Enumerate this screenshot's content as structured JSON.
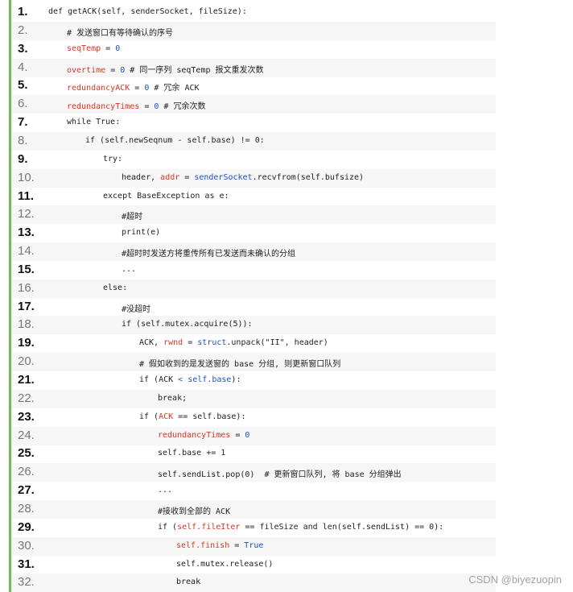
{
  "lines": [
    {
      "no": "1.",
      "tokens": [
        {
          "t": "def getACK(self, senderSocket, fileSize):"
        }
      ]
    },
    {
      "no": "2.",
      "tokens": [
        {
          "t": "# 发送窗口有等待确认的序号"
        }
      ]
    },
    {
      "no": "3.",
      "tokens": [
        {
          "t": "seqTemp",
          "c": "red"
        },
        {
          "t": " = "
        },
        {
          "t": "0",
          "c": "blue"
        }
      ]
    },
    {
      "no": "4.",
      "tokens": [
        {
          "t": "overtime",
          "c": "red"
        },
        {
          "t": " = "
        },
        {
          "t": "0",
          "c": "blue"
        },
        {
          "t": " # 同一序列 seqTemp 报文重发次数"
        }
      ]
    },
    {
      "no": "5.",
      "tokens": [
        {
          "t": "redundancyACK",
          "c": "red"
        },
        {
          "t": " = "
        },
        {
          "t": "0",
          "c": "blue"
        },
        {
          "t": " # 冗余 ACK"
        }
      ]
    },
    {
      "no": "6.",
      "tokens": [
        {
          "t": "redundancyTimes",
          "c": "red"
        },
        {
          "t": " = "
        },
        {
          "t": "0",
          "c": "blue"
        },
        {
          "t": " # 冗余次数"
        }
      ]
    },
    {
      "no": "7.",
      "tokens": [
        {
          "t": "while True:"
        }
      ]
    },
    {
      "no": "8.",
      "tokens": [
        {
          "t": "if (self.newSeqnum - self.base) != 0:"
        }
      ]
    },
    {
      "no": "9.",
      "tokens": [
        {
          "t": "try:"
        }
      ]
    },
    {
      "no": "10.",
      "tokens": [
        {
          "t": "header, "
        },
        {
          "t": "addr",
          "c": "red"
        },
        {
          "t": " = "
        },
        {
          "t": "senderSocket",
          "c": "blue"
        },
        {
          "t": ".recvfrom(self.bufsize)"
        }
      ]
    },
    {
      "no": "11.",
      "tokens": [
        {
          "t": "except BaseException as e:"
        }
      ]
    },
    {
      "no": "12.",
      "tokens": [
        {
          "t": "#超时"
        }
      ]
    },
    {
      "no": "13.",
      "tokens": [
        {
          "t": "print(e)"
        }
      ]
    },
    {
      "no": "14.",
      "tokens": [
        {
          "t": "#超时时发送方将重传所有已发送而未确认的分组"
        }
      ]
    },
    {
      "no": "15.",
      "tokens": [
        {
          "t": "..."
        }
      ]
    },
    {
      "no": "16.",
      "tokens": [
        {
          "t": "else:"
        }
      ]
    },
    {
      "no": "17.",
      "tokens": [
        {
          "t": "#没超时"
        }
      ]
    },
    {
      "no": "18.",
      "tokens": [
        {
          "t": "if (self.mutex.acquire(5)):"
        }
      ]
    },
    {
      "no": "19.",
      "tokens": [
        {
          "t": "ACK, "
        },
        {
          "t": "rwnd",
          "c": "red"
        },
        {
          "t": " = "
        },
        {
          "t": "struct",
          "c": "blue"
        },
        {
          "t": ".unpack(\"II\", header)"
        }
      ]
    },
    {
      "no": "20.",
      "tokens": [
        {
          "t": "# 假如收到的是发送窗的 base 分组, 则更新窗口队列"
        }
      ]
    },
    {
      "no": "21.",
      "tokens": [
        {
          "t": "if (ACK "
        },
        {
          "t": "<",
          "c": "blue"
        },
        {
          "t": " "
        },
        {
          "t": "self.base",
          "c": "blue"
        },
        {
          "t": "):"
        }
      ]
    },
    {
      "no": "22.",
      "tokens": [
        {
          "t": "break;"
        }
      ]
    },
    {
      "no": "23.",
      "tokens": [
        {
          "t": "if ("
        },
        {
          "t": "ACK",
          "c": "red"
        },
        {
          "t": " == self.base):"
        }
      ]
    },
    {
      "no": "24.",
      "tokens": [
        {
          "t": "redundancyTimes",
          "c": "red"
        },
        {
          "t": " = "
        },
        {
          "t": "0",
          "c": "blue"
        }
      ]
    },
    {
      "no": "25.",
      "tokens": [
        {
          "t": "self.base += 1"
        }
      ]
    },
    {
      "no": "26.",
      "tokens": [
        {
          "t": "self.sendList.pop(0)  # 更新窗口队列, 将 base 分组弹出"
        }
      ]
    },
    {
      "no": "27.",
      "tokens": [
        {
          "t": "..."
        }
      ]
    },
    {
      "no": "28.",
      "tokens": [
        {
          "t": "#接收到全部的 ACK"
        }
      ]
    },
    {
      "no": "29.",
      "tokens": [
        {
          "t": "if ("
        },
        {
          "t": "self.fileIter",
          "c": "red"
        },
        {
          "t": " == fileSize and len(self.sendList) == 0):"
        }
      ]
    },
    {
      "no": "30.",
      "tokens": [
        {
          "t": "self.finish",
          "c": "red"
        },
        {
          "t": " = "
        },
        {
          "t": "True",
          "c": "blue"
        }
      ]
    },
    {
      "no": "31.",
      "tokens": [
        {
          "t": "self.mutex.release()"
        }
      ]
    },
    {
      "no": "32.",
      "tokens": [
        {
          "t": "break"
        }
      ]
    }
  ],
  "watermark": "CSDN @biyezuopin",
  "colors": {
    "accent_bar": "#6cc04a",
    "keyword_red": "#d9361f",
    "keyword_blue": "#1a52c6",
    "alt_row": "#f6f6f6"
  }
}
